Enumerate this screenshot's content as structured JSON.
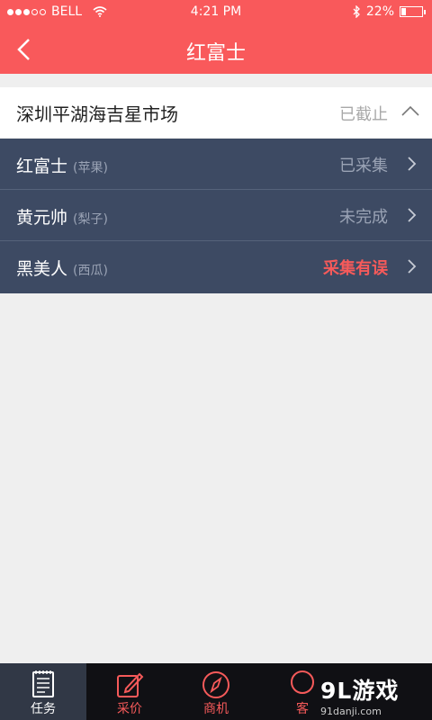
{
  "status_bar": {
    "carrier": "BELL",
    "time": "4:21 PM",
    "battery": "22%",
    "battery_level": 0.22,
    "signal_dots": [
      true,
      true,
      true,
      false,
      false
    ]
  },
  "nav": {
    "title": "红富士",
    "back_icon": "chevron-left-icon"
  },
  "market": {
    "name": "深圳平湖海吉星市场",
    "status": "已截止",
    "toggle_icon": "chevron-up-icon"
  },
  "tasks": [
    {
      "product": "红富士",
      "category": "(苹果)",
      "state": "已采集",
      "state_color": "#9aa3b5"
    },
    {
      "product": "黄元帅",
      "category": "(梨子)",
      "state": "未完成",
      "state_color": "#9aa3b5"
    },
    {
      "product": "黑美人",
      "category": "(西瓜)",
      "state": "采集有误",
      "state_color": "#f65a5a"
    }
  ],
  "tabs": [
    {
      "label": "任务",
      "icon": "notepad-icon",
      "active": true
    },
    {
      "label": "采价",
      "icon": "edit-icon",
      "active": false
    },
    {
      "label": "商机",
      "icon": "compass-icon",
      "active": false
    },
    {
      "label": "客",
      "icon": "user-icon",
      "active": false
    }
  ],
  "watermark": {
    "logo": "9L游戏",
    "site": "91danji.com"
  },
  "colors": {
    "accent": "#f9595b",
    "list_bg": "#3d4a63",
    "error": "#f65a5a",
    "tab_bg": "#101014"
  }
}
